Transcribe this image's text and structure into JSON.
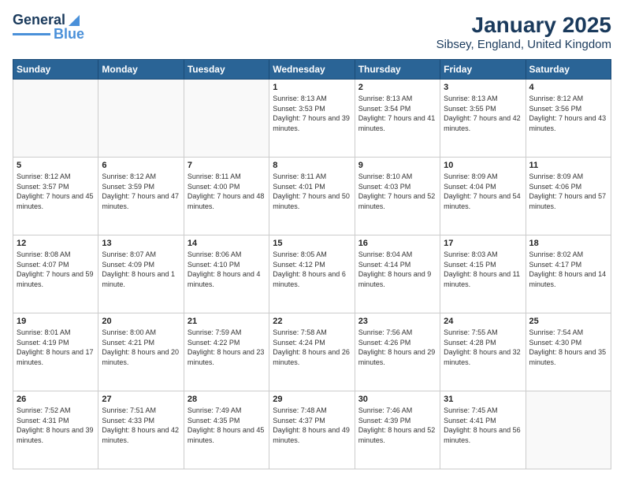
{
  "logo": {
    "line1": "General",
    "line2": "Blue"
  },
  "header": {
    "month": "January 2025",
    "location": "Sibsey, England, United Kingdom"
  },
  "weekdays": [
    "Sunday",
    "Monday",
    "Tuesday",
    "Wednesday",
    "Thursday",
    "Friday",
    "Saturday"
  ],
  "weeks": [
    [
      {
        "day": "",
        "info": ""
      },
      {
        "day": "",
        "info": ""
      },
      {
        "day": "",
        "info": ""
      },
      {
        "day": "1",
        "info": "Sunrise: 8:13 AM\nSunset: 3:53 PM\nDaylight: 7 hours\nand 39 minutes."
      },
      {
        "day": "2",
        "info": "Sunrise: 8:13 AM\nSunset: 3:54 PM\nDaylight: 7 hours\nand 41 minutes."
      },
      {
        "day": "3",
        "info": "Sunrise: 8:13 AM\nSunset: 3:55 PM\nDaylight: 7 hours\nand 42 minutes."
      },
      {
        "day": "4",
        "info": "Sunrise: 8:12 AM\nSunset: 3:56 PM\nDaylight: 7 hours\nand 43 minutes."
      }
    ],
    [
      {
        "day": "5",
        "info": "Sunrise: 8:12 AM\nSunset: 3:57 PM\nDaylight: 7 hours\nand 45 minutes."
      },
      {
        "day": "6",
        "info": "Sunrise: 8:12 AM\nSunset: 3:59 PM\nDaylight: 7 hours\nand 47 minutes."
      },
      {
        "day": "7",
        "info": "Sunrise: 8:11 AM\nSunset: 4:00 PM\nDaylight: 7 hours\nand 48 minutes."
      },
      {
        "day": "8",
        "info": "Sunrise: 8:11 AM\nSunset: 4:01 PM\nDaylight: 7 hours\nand 50 minutes."
      },
      {
        "day": "9",
        "info": "Sunrise: 8:10 AM\nSunset: 4:03 PM\nDaylight: 7 hours\nand 52 minutes."
      },
      {
        "day": "10",
        "info": "Sunrise: 8:09 AM\nSunset: 4:04 PM\nDaylight: 7 hours\nand 54 minutes."
      },
      {
        "day": "11",
        "info": "Sunrise: 8:09 AM\nSunset: 4:06 PM\nDaylight: 7 hours\nand 57 minutes."
      }
    ],
    [
      {
        "day": "12",
        "info": "Sunrise: 8:08 AM\nSunset: 4:07 PM\nDaylight: 7 hours\nand 59 minutes."
      },
      {
        "day": "13",
        "info": "Sunrise: 8:07 AM\nSunset: 4:09 PM\nDaylight: 8 hours\nand 1 minute."
      },
      {
        "day": "14",
        "info": "Sunrise: 8:06 AM\nSunset: 4:10 PM\nDaylight: 8 hours\nand 4 minutes."
      },
      {
        "day": "15",
        "info": "Sunrise: 8:05 AM\nSunset: 4:12 PM\nDaylight: 8 hours\nand 6 minutes."
      },
      {
        "day": "16",
        "info": "Sunrise: 8:04 AM\nSunset: 4:14 PM\nDaylight: 8 hours\nand 9 minutes."
      },
      {
        "day": "17",
        "info": "Sunrise: 8:03 AM\nSunset: 4:15 PM\nDaylight: 8 hours\nand 11 minutes."
      },
      {
        "day": "18",
        "info": "Sunrise: 8:02 AM\nSunset: 4:17 PM\nDaylight: 8 hours\nand 14 minutes."
      }
    ],
    [
      {
        "day": "19",
        "info": "Sunrise: 8:01 AM\nSunset: 4:19 PM\nDaylight: 8 hours\nand 17 minutes."
      },
      {
        "day": "20",
        "info": "Sunrise: 8:00 AM\nSunset: 4:21 PM\nDaylight: 8 hours\nand 20 minutes."
      },
      {
        "day": "21",
        "info": "Sunrise: 7:59 AM\nSunset: 4:22 PM\nDaylight: 8 hours\nand 23 minutes."
      },
      {
        "day": "22",
        "info": "Sunrise: 7:58 AM\nSunset: 4:24 PM\nDaylight: 8 hours\nand 26 minutes."
      },
      {
        "day": "23",
        "info": "Sunrise: 7:56 AM\nSunset: 4:26 PM\nDaylight: 8 hours\nand 29 minutes."
      },
      {
        "day": "24",
        "info": "Sunrise: 7:55 AM\nSunset: 4:28 PM\nDaylight: 8 hours\nand 32 minutes."
      },
      {
        "day": "25",
        "info": "Sunrise: 7:54 AM\nSunset: 4:30 PM\nDaylight: 8 hours\nand 35 minutes."
      }
    ],
    [
      {
        "day": "26",
        "info": "Sunrise: 7:52 AM\nSunset: 4:31 PM\nDaylight: 8 hours\nand 39 minutes."
      },
      {
        "day": "27",
        "info": "Sunrise: 7:51 AM\nSunset: 4:33 PM\nDaylight: 8 hours\nand 42 minutes."
      },
      {
        "day": "28",
        "info": "Sunrise: 7:49 AM\nSunset: 4:35 PM\nDaylight: 8 hours\nand 45 minutes."
      },
      {
        "day": "29",
        "info": "Sunrise: 7:48 AM\nSunset: 4:37 PM\nDaylight: 8 hours\nand 49 minutes."
      },
      {
        "day": "30",
        "info": "Sunrise: 7:46 AM\nSunset: 4:39 PM\nDaylight: 8 hours\nand 52 minutes."
      },
      {
        "day": "31",
        "info": "Sunrise: 7:45 AM\nSunset: 4:41 PM\nDaylight: 8 hours\nand 56 minutes."
      },
      {
        "day": "",
        "info": ""
      }
    ]
  ]
}
